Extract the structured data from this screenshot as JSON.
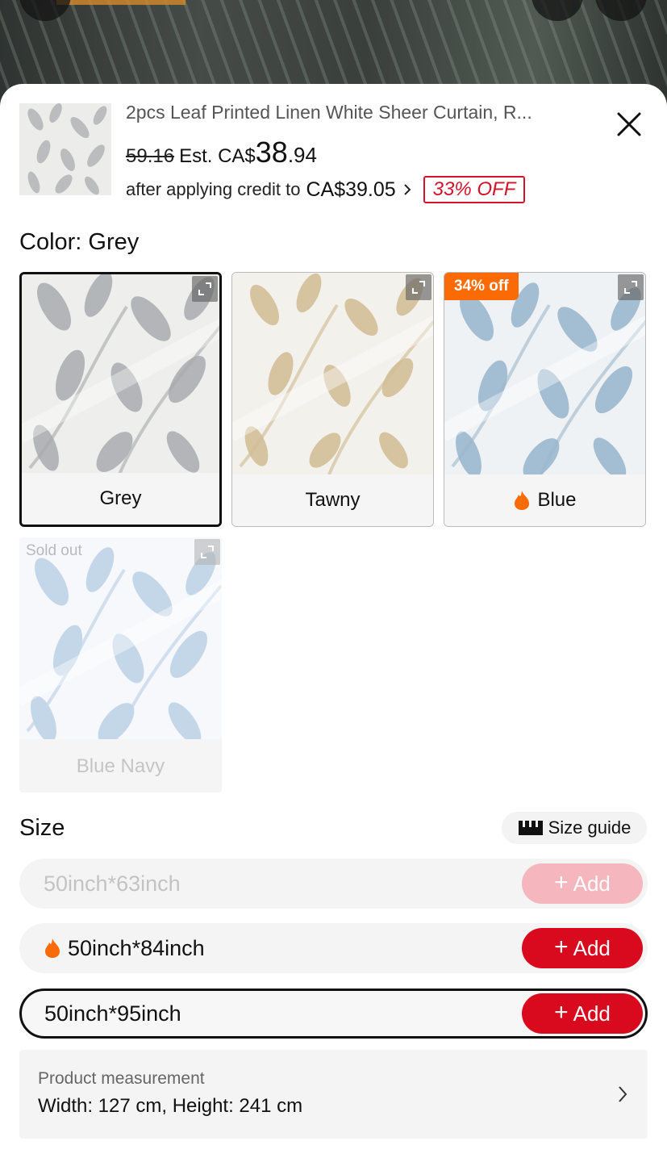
{
  "product": {
    "title": "2pcs Leaf Printed Linen White Sheer Curtain, R...",
    "old_price": "59.16",
    "est_label": "Est. CA$",
    "price_int": "38",
    "price_dec": ".94",
    "credit_text": "after applying credit to",
    "credit_amount": "CA$39.05",
    "off_badge": "33% OFF"
  },
  "color": {
    "label": "Color: Grey",
    "options": [
      {
        "name": "Grey",
        "selected": true,
        "leaf_color": "#a9acaf"
      },
      {
        "name": "Tawny",
        "selected": false,
        "leaf_color": "#d3bf98"
      },
      {
        "name": "Blue",
        "selected": false,
        "badge": "34% off",
        "hot": true,
        "leaf_color": "#9bb8cf"
      },
      {
        "name": "Blue Navy",
        "sold_out": true,
        "sold_label": "Sold out",
        "leaf_color": "#94b6d8"
      }
    ]
  },
  "size": {
    "label": "Size",
    "guide_label": "Size guide",
    "options": [
      {
        "name": "50inch*63inch",
        "disabled": true,
        "add_label": "Add"
      },
      {
        "name": "50inch*84inch",
        "hot": true,
        "add_label": "Add"
      },
      {
        "name": "50inch*95inch",
        "selected": true,
        "add_label": "Add"
      }
    ]
  },
  "measurement": {
    "label": "Product measurement",
    "value": "Width: 127 cm, Height: 241 cm"
  },
  "colors": {
    "accent": "#d90a1e",
    "orange": "#fa6a05"
  }
}
